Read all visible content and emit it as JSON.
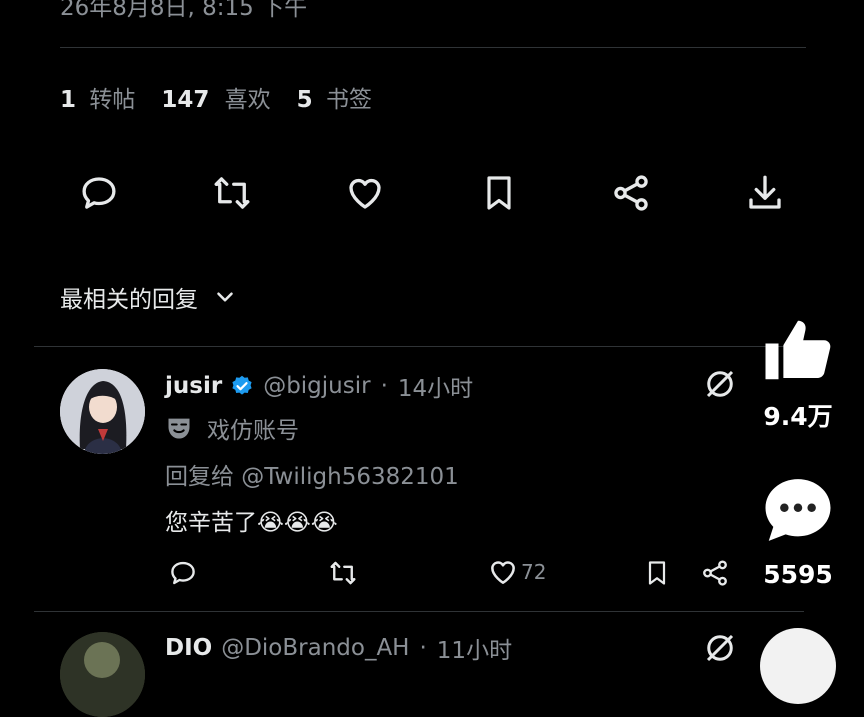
{
  "tweet": {
    "timestamp": "26年8月8日, 8:15 下午",
    "stats": [
      {
        "count": "1",
        "label": "转帖"
      },
      {
        "count": "147",
        "label": "喜欢"
      },
      {
        "count": "5",
        "label": "书签"
      }
    ],
    "actions": [
      "reply-icon",
      "retweet-icon",
      "like-icon",
      "bookmark-icon",
      "share-icon",
      "download-icon"
    ]
  },
  "replies_header": {
    "label": "最相关的回复"
  },
  "replies": [
    {
      "name": "jusir",
      "handle": "@bigjusir",
      "separator": "·",
      "time": "14小时",
      "parody_label": "戏仿账号",
      "reply_to": "回复给 @Twiligh56382101",
      "text": "您辛苦了😭😭😭",
      "likes": "72"
    },
    {
      "name": "DIO",
      "handle": "@DioBrando_AH",
      "separator": "·",
      "time": "11小时"
    }
  ],
  "overlay": {
    "like_count": "9.4万",
    "comment_count": "5595"
  },
  "colors": {
    "background": "#000000",
    "text": "#e7e9ea",
    "muted": "#71767b",
    "verified": "#1d9bf0",
    "divider": "#2f3336"
  }
}
